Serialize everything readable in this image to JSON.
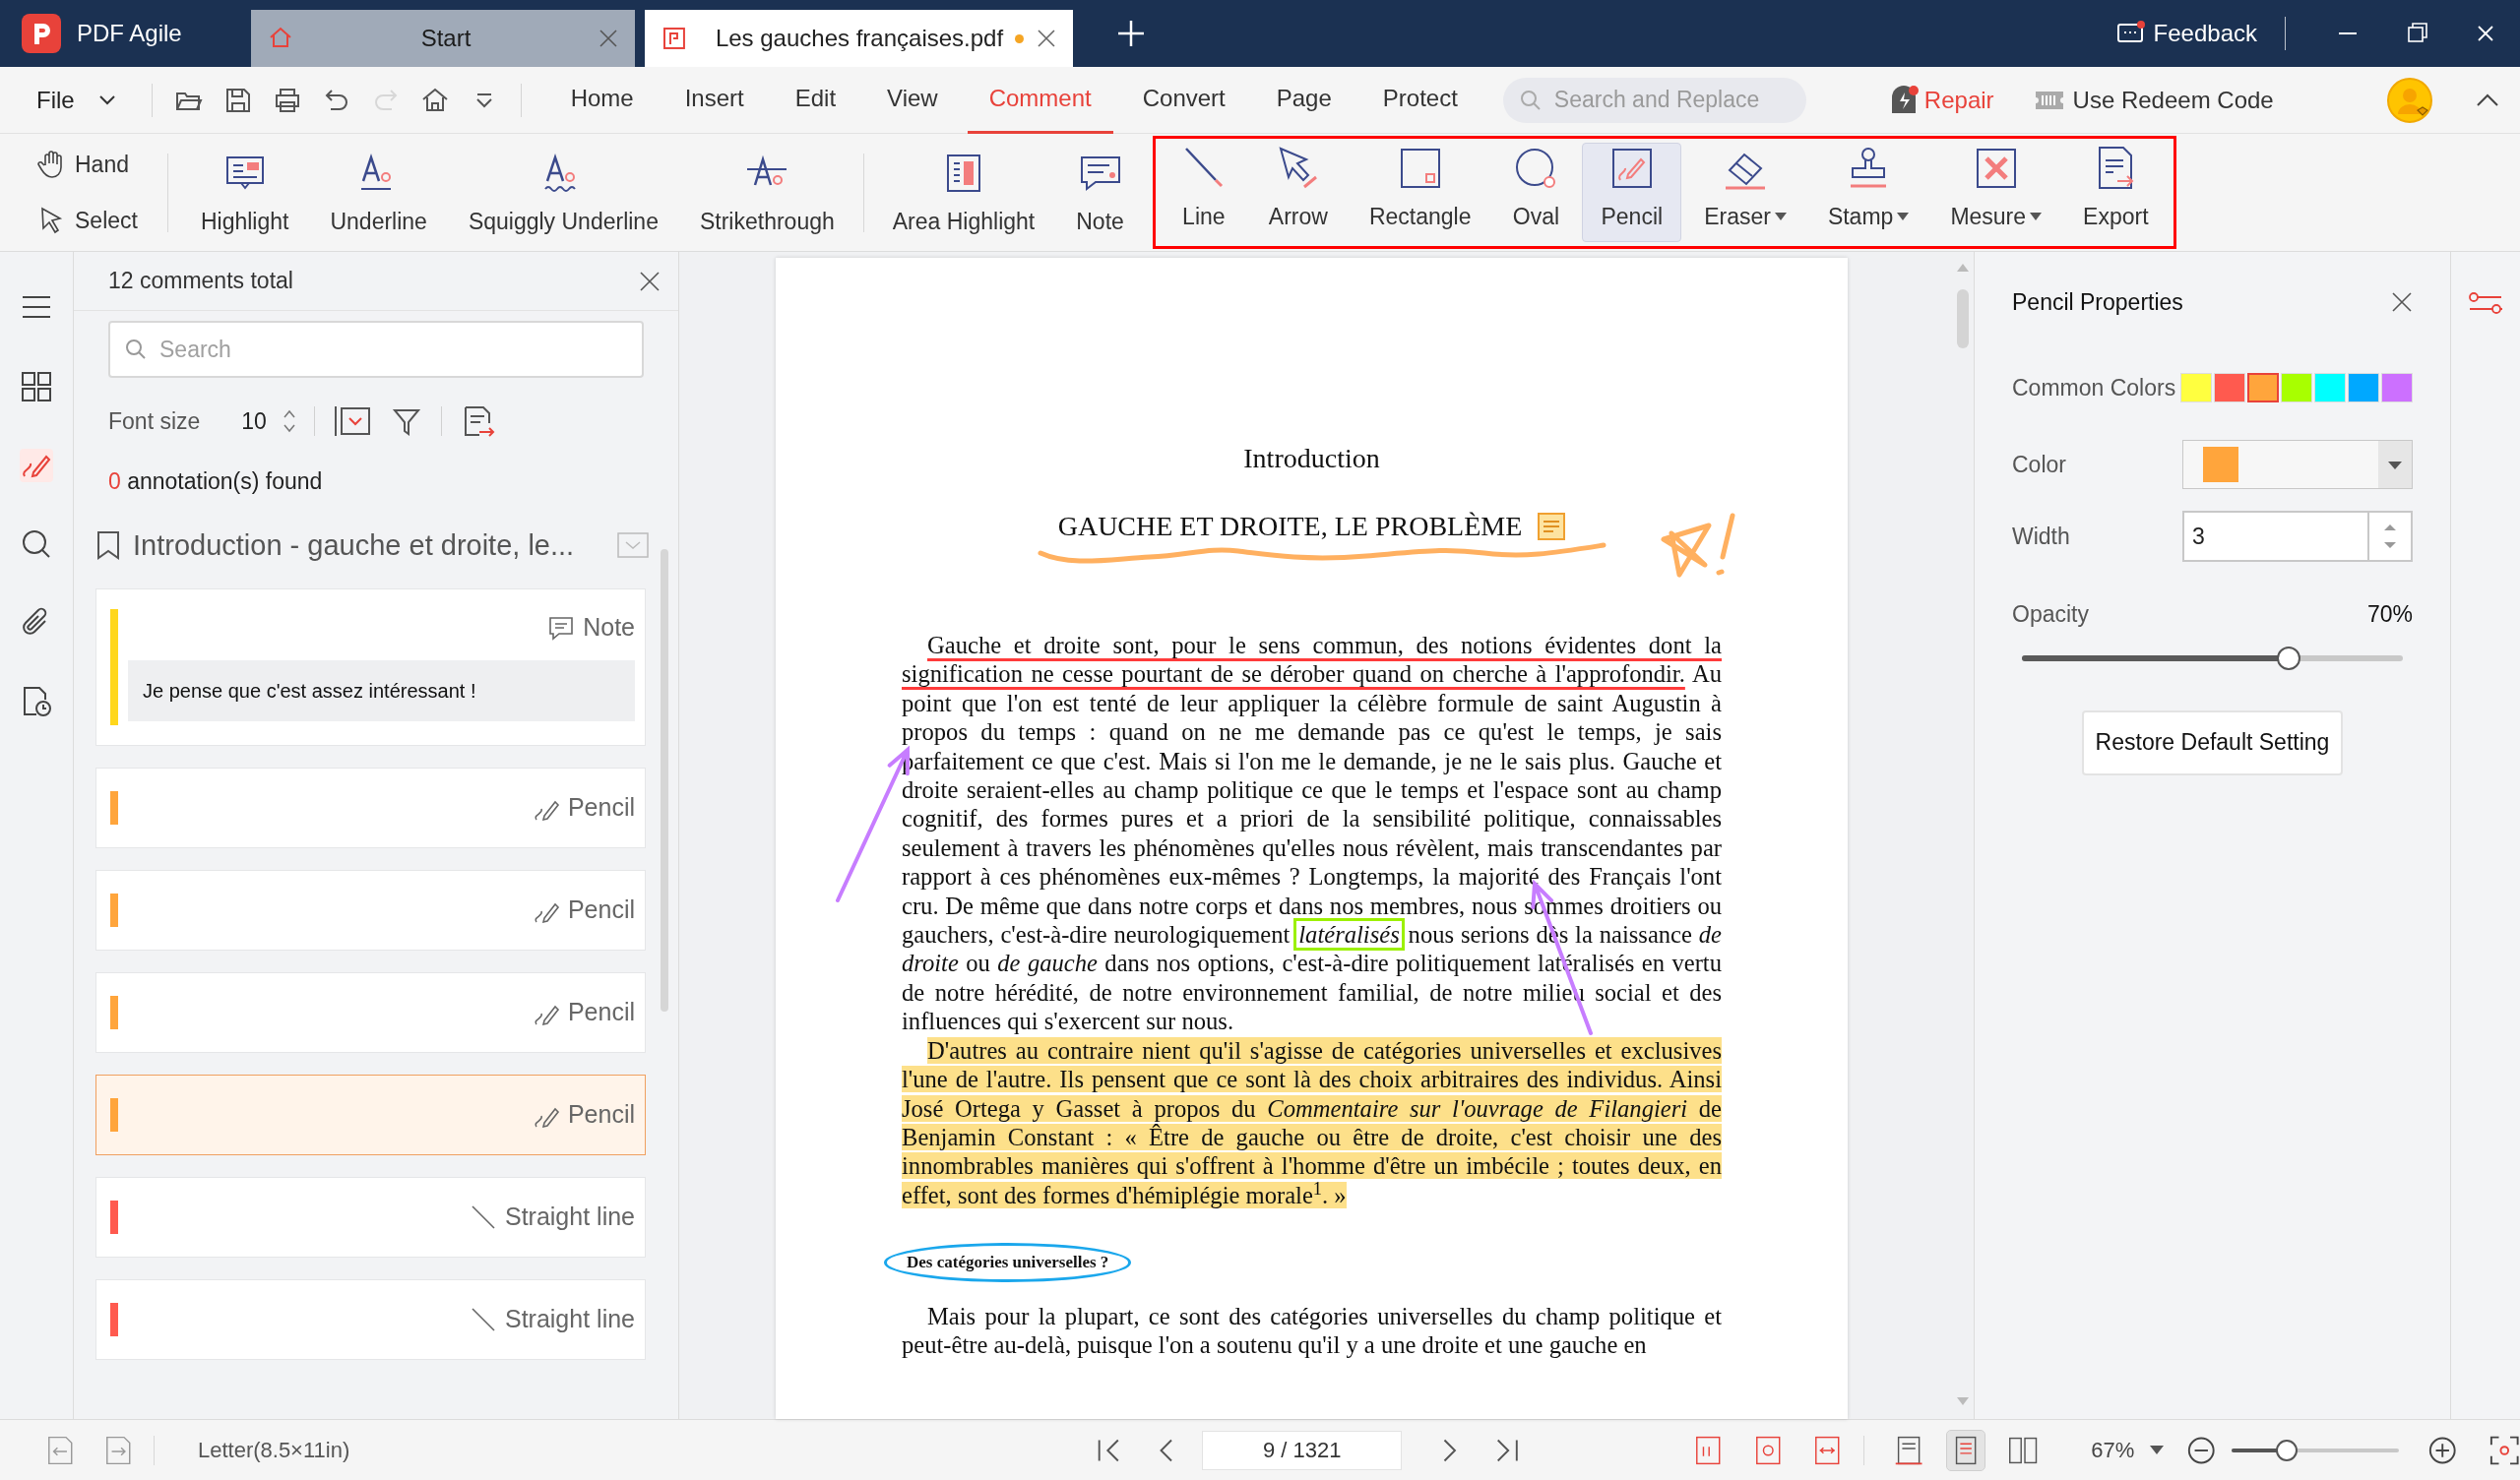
{
  "title_bar": {
    "app_name": "PDF Agile",
    "tabs": [
      {
        "label": "Start",
        "kind": "home",
        "selected": false,
        "modified": false
      },
      {
        "label": "Les gauches françaises.pdf",
        "kind": "pdf",
        "selected": true,
        "modified": true
      }
    ],
    "feedback": "Feedback"
  },
  "menu_bar": {
    "file": "File",
    "quick_access": [
      {
        "kind": "open",
        "disabled": false
      },
      {
        "kind": "save",
        "disabled": false
      },
      {
        "kind": "print",
        "disabled": false
      },
      {
        "kind": "undo",
        "disabled": false
      },
      {
        "kind": "redo",
        "disabled": true
      },
      {
        "kind": "home",
        "disabled": false
      },
      {
        "kind": "more",
        "disabled": false
      }
    ],
    "tabs": [
      {
        "label": "Home",
        "selected": false
      },
      {
        "label": "Insert",
        "selected": false
      },
      {
        "label": "Edit",
        "selected": false
      },
      {
        "label": "View",
        "selected": false
      },
      {
        "label": "Comment",
        "selected": true
      },
      {
        "label": "Convert",
        "selected": false
      },
      {
        "label": "Page",
        "selected": false
      },
      {
        "label": "Protect",
        "selected": false
      }
    ],
    "search": {
      "placeholder": "Search and Replace"
    },
    "repair": "Repair",
    "redeem": "Use Redeem Code"
  },
  "ribbon": {
    "navigation": [
      {
        "label": "Hand",
        "kind": "hand",
        "selected": false
      },
      {
        "label": "Select",
        "kind": "select",
        "selected": false
      }
    ],
    "markup_tools": [
      {
        "label": "Highlight",
        "kind": "highlight",
        "selected": false
      },
      {
        "label": "Underline",
        "kind": "underline",
        "selected": false
      },
      {
        "label": "Squiggly Underline",
        "kind": "squiggly",
        "selected": false
      },
      {
        "label": "Strikethrough",
        "kind": "strikethrough",
        "selected": false
      },
      {
        "label": "Area Highlight",
        "kind": "area",
        "selected": false
      },
      {
        "label": "Note",
        "kind": "note",
        "selected": false
      }
    ],
    "drawing_tools": [
      {
        "label": "Line",
        "kind": "line",
        "selected": false,
        "dropdown": false
      },
      {
        "label": "Arrow",
        "kind": "arrow",
        "selected": false,
        "dropdown": false
      },
      {
        "label": "Rectangle",
        "kind": "rectangle",
        "selected": false,
        "dropdown": false
      },
      {
        "label": "Oval",
        "kind": "oval",
        "selected": false,
        "dropdown": false
      },
      {
        "label": "Pencil",
        "kind": "pencil",
        "selected": true,
        "dropdown": false
      },
      {
        "label": "Eraser",
        "kind": "eraser",
        "selected": false,
        "dropdown": true
      },
      {
        "label": "Stamp",
        "kind": "stamp",
        "selected": false,
        "dropdown": true
      },
      {
        "label": "Mesure",
        "kind": "measure",
        "selected": false,
        "dropdown": true
      },
      {
        "label": "Export",
        "kind": "export",
        "selected": false,
        "dropdown": false
      }
    ]
  },
  "sidebar": {
    "items": [
      {
        "kind": "menu",
        "selected": false
      },
      {
        "kind": "thumbnails",
        "selected": false
      },
      {
        "kind": "comments",
        "selected": true
      },
      {
        "kind": "search",
        "selected": false
      },
      {
        "kind": "attachments",
        "selected": false
      },
      {
        "kind": "history",
        "selected": false
      }
    ]
  },
  "comments_panel": {
    "title": "12 comments total",
    "search": {
      "placeholder": "Search"
    },
    "font_size_label": "Font size",
    "font_size": "10",
    "found_count": "0",
    "found_label": "annotation(s) found",
    "group": {
      "title": "Introduction - gauche et droite, le...",
      "comments": [
        {
          "kind": "note",
          "type_label": "Note",
          "color": "#ffd71c",
          "selected": false,
          "text": "Je pense que c'est assez intéressant !"
        },
        {
          "kind": "pencil",
          "type_label": "Pencil",
          "color": "#ffa53c",
          "selected": false
        },
        {
          "kind": "pencil",
          "type_label": "Pencil",
          "color": "#ffa53c",
          "selected": false
        },
        {
          "kind": "pencil",
          "type_label": "Pencil",
          "color": "#ffa53c",
          "selected": false
        },
        {
          "kind": "pencil",
          "type_label": "Pencil",
          "color": "#ffa53c",
          "selected": true
        },
        {
          "kind": "line",
          "type_label": "Straight line",
          "color": "#ff5a4f",
          "selected": false
        },
        {
          "kind": "line",
          "type_label": "Straight line",
          "color": "#ff5a4f",
          "selected": false
        }
      ]
    }
  },
  "document": {
    "title": "Introduction",
    "heading": "GAUCHE ET DROITE, LE PROBLÈME",
    "paragraphs": [
      {
        "segments": [
          {
            "kind": "underlined",
            "text": "Gauche et droite sont, pour le sens commun, des notions évidentes dont la signification ne cesse pourtant de se dérober quand on cherche à l'approfondir."
          },
          {
            "kind": "plain",
            "text": " Au point que l'on est tenté de leur appliquer la célèbre formule de saint Augustin à propos du temps : quand on ne me demande pas ce qu'est le temps, je sais parfaitement ce que c'est. Mais si l'on me le demande, je ne le sais plus. Gauche et droite seraient-elles au champ politique ce que le temps et l'espace sont au champ cognitif, des formes pures et a priori de la sensibilité politique, connaissables seulement à travers les phénomènes qu'elles nous révèlent, mais transcendantes par rapport à ces phénomènes eux-mêmes ? Longtemps, la majorité des Français l'ont cru. De même que dans notre corps et dans nos membres, nous sommes droitiers ou gauchers, c'est-à-dire neurologiquement "
          },
          {
            "kind": "boxed",
            "text": "*latéralisés*"
          },
          {
            "kind": "plain",
            "text": " nous serions dès la naissance *de droite* ou *de gauche* dans nos options, c'est-à-dire politiquement latéralisés en vertu de notre hérédité, de notre environnement familial, de notre milieu social et des influences qui s'exercent sur nous."
          }
        ]
      },
      {
        "segments": [
          {
            "kind": "highlighted",
            "text": "D'autres au contraire nient qu'il s'agisse de catégories universelles et exclusives l'une de l'autre. Ils pensent que ce sont là des choix arbitraires des individus. Ainsi José Ortega y Gasset à propos du *Commentaire sur l'ouvrage de Filangieri* de Benjamin Constant : « Être de gauche ou être de droite, c'est choisir une des innombrables manières qui s'offrent à l'homme d'être un imbécile ; toutes deux, en effet, sont des formes d'hémiplégie morale$^{1}$. »"
          }
        ]
      }
    ],
    "subheading": "Des catégories universelles ?",
    "closing_paragraphs": [
      {
        "segments": [
          {
            "kind": "plain",
            "text": "Mais pour la plupart, ce sont des catégories universelles du champ politique et peut-être au-delà, puisque l'on a soutenu qu'il y a une droite et une gauche en"
          }
        ]
      }
    ]
  },
  "properties_panel": {
    "title": "Pencil Properties",
    "common_colors_label": "Common Colors",
    "swatches": [
      {
        "color": "#ffff40",
        "selected": false
      },
      {
        "color": "#ff5a4f",
        "selected": false
      },
      {
        "color": "#ffa53c",
        "selected": true
      },
      {
        "color": "#a8ff00",
        "selected": false
      },
      {
        "color": "#00ffff",
        "selected": false
      },
      {
        "color": "#00a8ff",
        "selected": false
      },
      {
        "color": "#cc70ff",
        "selected": false
      }
    ],
    "color_label": "Color",
    "selected_color": {
      "color": "#ffa53c"
    },
    "width_label": "Width",
    "width_value": "3",
    "opacity_label": "Opacity",
    "opacity_value": "70%",
    "opacity_slider": {
      "level": 0.7
    },
    "restore_button": "Restore Default Setting"
  },
  "status_bar": {
    "page_size": "Letter(8.5×11in)",
    "page": "9 / 1321",
    "zoom": "67%",
    "zoom_slider": {
      "level": 0.33
    },
    "view_modes": [
      {
        "kind": "single",
        "selected": false
      },
      {
        "kind": "continuous",
        "selected": true
      },
      {
        "kind": "double",
        "selected": false
      }
    ]
  }
}
